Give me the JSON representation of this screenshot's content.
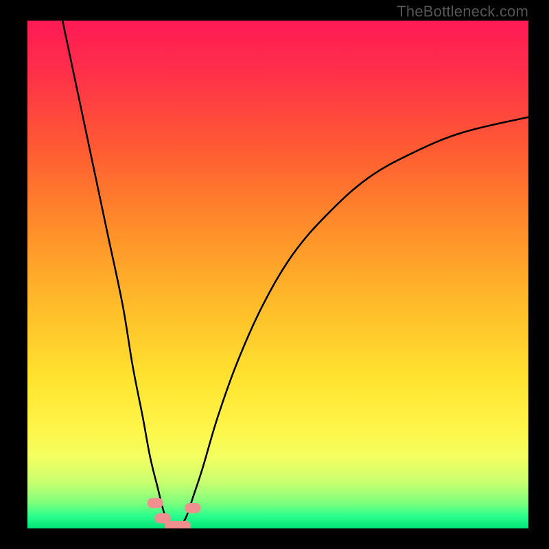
{
  "attribution": "TheBottleneck.com",
  "gradient_stops": [
    {
      "offset": 0.0,
      "color": "#ff1a55"
    },
    {
      "offset": 0.1,
      "color": "#ff2f4a"
    },
    {
      "offset": 0.25,
      "color": "#ff5a33"
    },
    {
      "offset": 0.4,
      "color": "#ff8b2a"
    },
    {
      "offset": 0.55,
      "color": "#ffb92a"
    },
    {
      "offset": 0.7,
      "color": "#ffe22f"
    },
    {
      "offset": 0.8,
      "color": "#fff548"
    },
    {
      "offset": 0.86,
      "color": "#f3ff60"
    },
    {
      "offset": 0.91,
      "color": "#c8ff70"
    },
    {
      "offset": 0.95,
      "color": "#7dff7d"
    },
    {
      "offset": 0.975,
      "color": "#2dff8c"
    },
    {
      "offset": 1.0,
      "color": "#00e57a"
    }
  ],
  "chart_data": {
    "type": "line",
    "title": "",
    "xlabel": "",
    "ylabel": "",
    "xlim": [
      0,
      100
    ],
    "ylim": [
      0,
      100
    ],
    "grid": false,
    "series": [
      {
        "name": "bottleneck-curve",
        "x": [
          7,
          10,
          13,
          16,
          19,
          21,
          23,
          24.5,
          26,
          27,
          28,
          29,
          30,
          31,
          32,
          33,
          35,
          38,
          42,
          47,
          53,
          60,
          68,
          77,
          87,
          100
        ],
        "y": [
          100,
          86,
          72,
          58,
          44,
          32,
          22,
          14,
          8,
          4,
          1,
          0,
          0,
          1,
          3,
          6,
          12,
          22,
          33,
          44,
          54,
          62,
          69,
          74,
          78,
          81
        ]
      }
    ],
    "markers": [
      {
        "x": 25.5,
        "y": 5.0
      },
      {
        "x": 27.0,
        "y": 2.0
      },
      {
        "x": 29.0,
        "y": 0.5
      },
      {
        "x": 31.0,
        "y": 0.5
      },
      {
        "x": 33.0,
        "y": 4.0
      }
    ],
    "curve_color": "#000000",
    "marker_color": "#ef8f8f"
  }
}
